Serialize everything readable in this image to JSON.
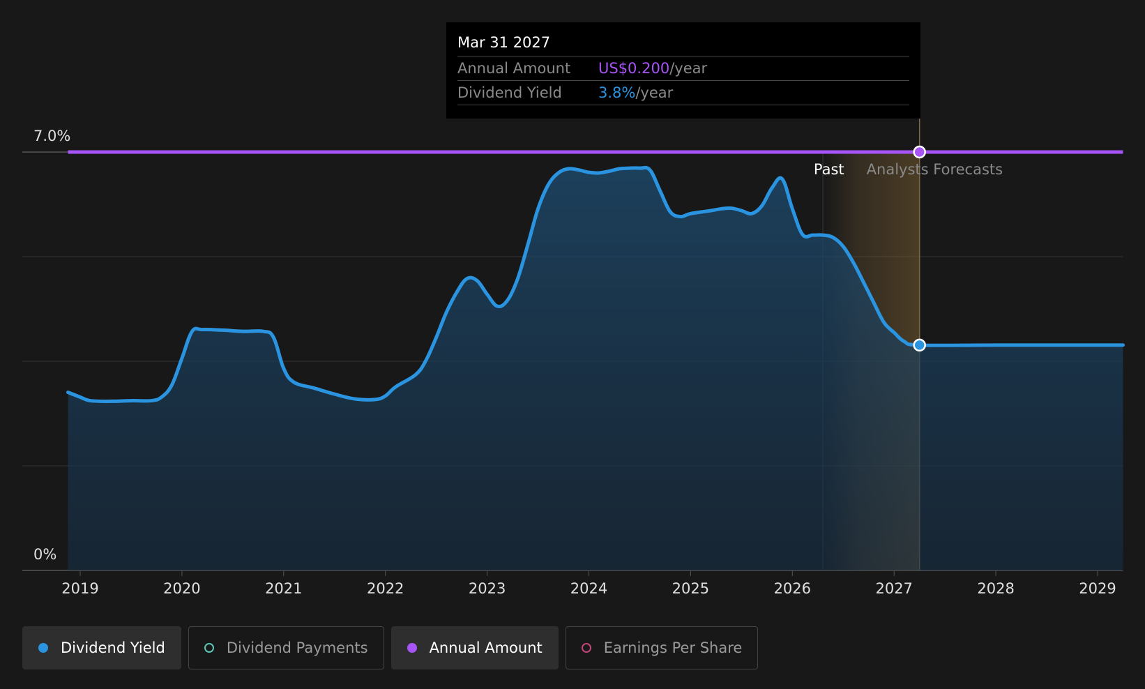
{
  "chart_data": {
    "type": "line",
    "x_ticks": [
      "2019",
      "2020",
      "2021",
      "2022",
      "2023",
      "2024",
      "2025",
      "2026",
      "2027",
      "2028",
      "2029"
    ],
    "y_labels": {
      "top": "7.0%",
      "bottom": "0%"
    },
    "ylim": [
      0,
      7.0
    ],
    "xlim": [
      2018.88,
      2029.25
    ],
    "past_label": "Past",
    "forecast_label": "Analysts Forecasts",
    "past_forecast_boundary": 2026.3,
    "highlight_date": 2027.25,
    "series": [
      {
        "name": "Dividend Yield",
        "color": "#2a94e0",
        "points": [
          [
            2019.0,
            2.9
          ],
          [
            2019.1,
            2.84
          ],
          [
            2019.3,
            2.83
          ],
          [
            2019.5,
            2.84
          ],
          [
            2019.7,
            2.84
          ],
          [
            2019.8,
            2.9
          ],
          [
            2019.9,
            3.1
          ],
          [
            2020.0,
            3.55
          ],
          [
            2020.1,
            4.0
          ],
          [
            2020.2,
            4.03
          ],
          [
            2020.4,
            4.02
          ],
          [
            2020.6,
            4.0
          ],
          [
            2020.8,
            4.0
          ],
          [
            2020.9,
            3.9
          ],
          [
            2021.0,
            3.38
          ],
          [
            2021.1,
            3.15
          ],
          [
            2021.3,
            3.05
          ],
          [
            2021.5,
            2.95
          ],
          [
            2021.7,
            2.87
          ],
          [
            2021.9,
            2.86
          ],
          [
            2022.0,
            2.92
          ],
          [
            2022.1,
            3.07
          ],
          [
            2022.3,
            3.28
          ],
          [
            2022.4,
            3.52
          ],
          [
            2022.5,
            3.9
          ],
          [
            2022.6,
            4.32
          ],
          [
            2022.7,
            4.65
          ],
          [
            2022.8,
            4.88
          ],
          [
            2022.9,
            4.85
          ],
          [
            2023.0,
            4.62
          ],
          [
            2023.1,
            4.42
          ],
          [
            2023.2,
            4.52
          ],
          [
            2023.3,
            4.88
          ],
          [
            2023.4,
            5.45
          ],
          [
            2023.5,
            6.05
          ],
          [
            2023.6,
            6.45
          ],
          [
            2023.7,
            6.65
          ],
          [
            2023.8,
            6.72
          ],
          [
            2023.9,
            6.7
          ],
          [
            2024.0,
            6.66
          ],
          [
            2024.1,
            6.65
          ],
          [
            2024.2,
            6.68
          ],
          [
            2024.3,
            6.72
          ],
          [
            2024.4,
            6.73
          ],
          [
            2024.5,
            6.73
          ],
          [
            2024.6,
            6.7
          ],
          [
            2024.7,
            6.35
          ],
          [
            2024.8,
            6.0
          ],
          [
            2024.9,
            5.92
          ],
          [
            2025.0,
            5.97
          ],
          [
            2025.2,
            6.02
          ],
          [
            2025.3,
            6.05
          ],
          [
            2025.4,
            6.06
          ],
          [
            2025.5,
            6.02
          ],
          [
            2025.6,
            5.97
          ],
          [
            2025.7,
            6.1
          ],
          [
            2025.8,
            6.4
          ],
          [
            2025.9,
            6.55
          ],
          [
            2026.0,
            6.05
          ],
          [
            2026.1,
            5.62
          ],
          [
            2026.2,
            5.61
          ],
          [
            2026.3,
            5.61
          ],
          [
            2026.4,
            5.57
          ],
          [
            2026.5,
            5.42
          ],
          [
            2026.6,
            5.15
          ],
          [
            2026.7,
            4.82
          ],
          [
            2026.8,
            4.48
          ],
          [
            2026.9,
            4.15
          ],
          [
            2027.0,
            3.98
          ],
          [
            2027.1,
            3.83
          ],
          [
            2027.25,
            3.77
          ],
          [
            2028.0,
            3.77
          ],
          [
            2029.25,
            3.77
          ]
        ]
      },
      {
        "name": "Annual Amount",
        "color": "#a855f7",
        "points": [
          [
            2018.88,
            7.0
          ],
          [
            2029.25,
            7.0
          ]
        ]
      }
    ],
    "tooltip": {
      "date": "Mar 31 2027",
      "rows": [
        {
          "label": "Annual Amount",
          "value": "US$0.200",
          "unit": "/year"
        },
        {
          "label": "Dividend Yield",
          "value": "3.8%",
          "unit": "/year"
        }
      ]
    }
  },
  "legend": [
    {
      "label": "Dividend Yield",
      "color": "#2a94e0",
      "filled": true,
      "active": true
    },
    {
      "label": "Dividend Payments",
      "color": "#5ec4b6",
      "filled": false,
      "active": false
    },
    {
      "label": "Annual Amount",
      "color": "#a855f7",
      "filled": true,
      "active": true
    },
    {
      "label": "Earnings Per Share",
      "color": "#c2457a",
      "filled": false,
      "active": false
    }
  ]
}
